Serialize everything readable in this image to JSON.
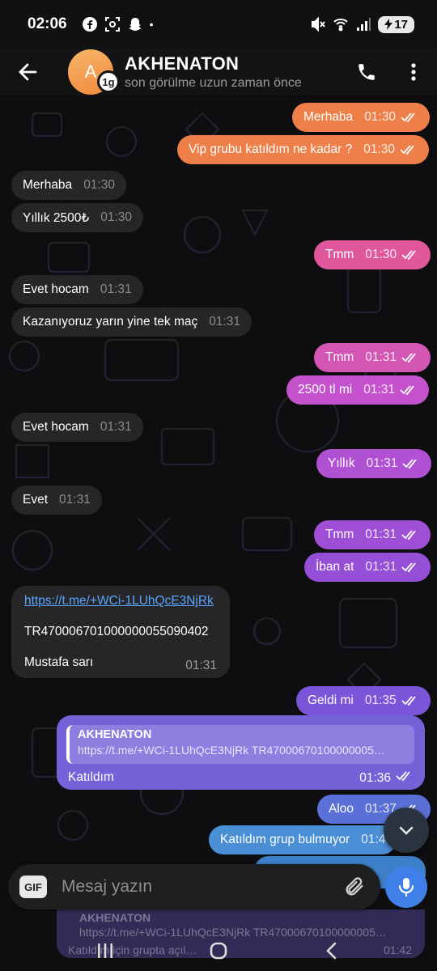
{
  "status_bar": {
    "time": "02:06",
    "battery": "17",
    "more_dot": "•"
  },
  "header": {
    "avatar_letter": "A",
    "avatar_badge": "1g",
    "name": "AKHENATON",
    "status": "son görülme uzun zaman önce"
  },
  "messages": [
    {
      "dir": "out",
      "text": "Merhaba",
      "time": "01:30",
      "color": "#ee7f49"
    },
    {
      "dir": "out",
      "text": "Vip grubu katıldım ne kadar ?",
      "time": "01:30",
      "color": "#ee7f49"
    },
    {
      "dir": "in",
      "text": "Merhaba",
      "time": "01:30"
    },
    {
      "dir": "in",
      "text": "Yıllık 2500₺",
      "time": "01:30"
    },
    {
      "dir": "out",
      "text": "Tmm",
      "time": "01:30",
      "color": "#e0589b"
    },
    {
      "dir": "in",
      "text": "Evet hocam",
      "time": "01:31"
    },
    {
      "dir": "in",
      "text": "Kazanıyoruz yarın yine tek maç",
      "time": "01:31"
    },
    {
      "dir": "out",
      "text": "Tmm",
      "time": "01:31",
      "color": "#d356b4"
    },
    {
      "dir": "out",
      "text": "2500 tl mi",
      "time": "01:31",
      "color": "#c452cc"
    },
    {
      "dir": "in",
      "text": "Evet hocam",
      "time": "01:31"
    },
    {
      "dir": "out",
      "text": "Yıllık",
      "time": "01:31",
      "color": "#b050d2"
    },
    {
      "dir": "in",
      "text": "Evet",
      "time": "01:31"
    },
    {
      "dir": "out",
      "text": "Tmm",
      "time": "01:31",
      "color": "#9f4fd5"
    },
    {
      "dir": "out",
      "text": "İban at",
      "time": "01:31",
      "color": "#954fd6"
    }
  ],
  "payment_message": {
    "link": "https://t.me/+WCi-1LUhQcE3NjRk",
    "iban": "TR470006701000000055090402",
    "name": "Mustafa sarı",
    "time": "01:31"
  },
  "after_messages": [
    {
      "text": "Geldi mi",
      "time": "01:35",
      "color": "#7a55d8"
    }
  ],
  "reply_message": {
    "quote_name": "AKHENATON",
    "quote_text": "https://t.me/+WCi-1LUhQcE3NjRk  TR47000670100000005…",
    "text": "Katıldım",
    "time": "01:36"
  },
  "tail_messages": [
    {
      "text": "Aloo",
      "time": "01:37",
      "color": "#5a70d6"
    },
    {
      "text": "Katıldım grup bulmuyor",
      "time": "01:4",
      "color": "#4a8fd5"
    }
  ],
  "ghost_preview": {
    "name": "AKHENATON",
    "quote": "https://t.me/+WCi-1LUhQcE3NjRk  TR47000670100000005…",
    "text": "Katıldım için grupta açıl…",
    "time": "01:42"
  },
  "composer": {
    "gif_label": "GIF",
    "placeholder": "Mesaj yazın"
  },
  "colors": {
    "accent_blue": "#3f7fe8",
    "incoming": "#262628",
    "link": "#5aa6ff"
  }
}
